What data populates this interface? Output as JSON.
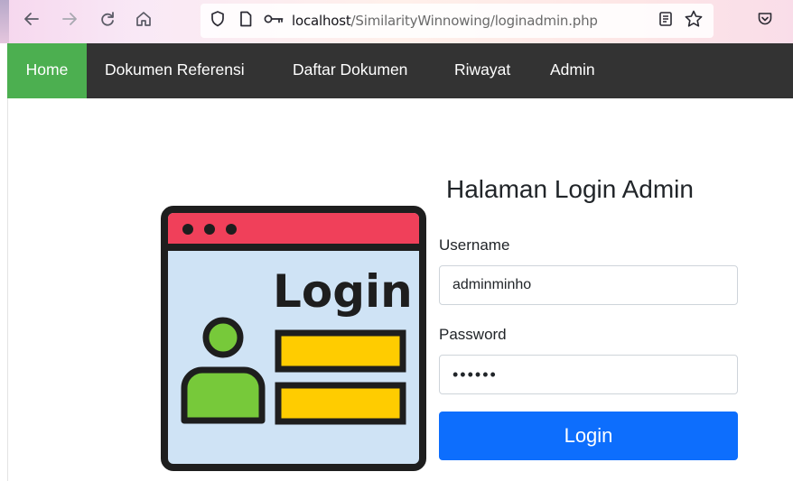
{
  "browser": {
    "url_host": "localhost",
    "url_path": "/SimilarityWinnowing/loginadmin.php",
    "icons": [
      "back-arrow-icon",
      "forward-arrow-icon",
      "reload-icon",
      "home-icon",
      "shield-icon",
      "page-icon",
      "key-icon",
      "reader-mode-icon",
      "bookmark-star-icon",
      "pocket-icon"
    ]
  },
  "nav": {
    "items": [
      {
        "label": "Home",
        "active": true
      },
      {
        "label": "Dokumen Referensi",
        "active": false
      },
      {
        "label": "Daftar Dokumen",
        "active": false
      },
      {
        "label": "Riwayat",
        "active": false
      },
      {
        "label": "Admin",
        "active": false
      }
    ],
    "bar_color": "#333333",
    "active_color": "#4caf50"
  },
  "login": {
    "title": "Halaman Login Admin",
    "username_label": "Username",
    "username_value": "adminminho",
    "password_label": "Password",
    "password_value": "••••••",
    "button_label": "Login",
    "button_color": "#0d6efd"
  },
  "illustration": {
    "text": "Login",
    "header_color": "#f0405a",
    "panel_color": "#cfe3f5",
    "field_color": "#ffcc00",
    "person_color": "#77c93a"
  }
}
